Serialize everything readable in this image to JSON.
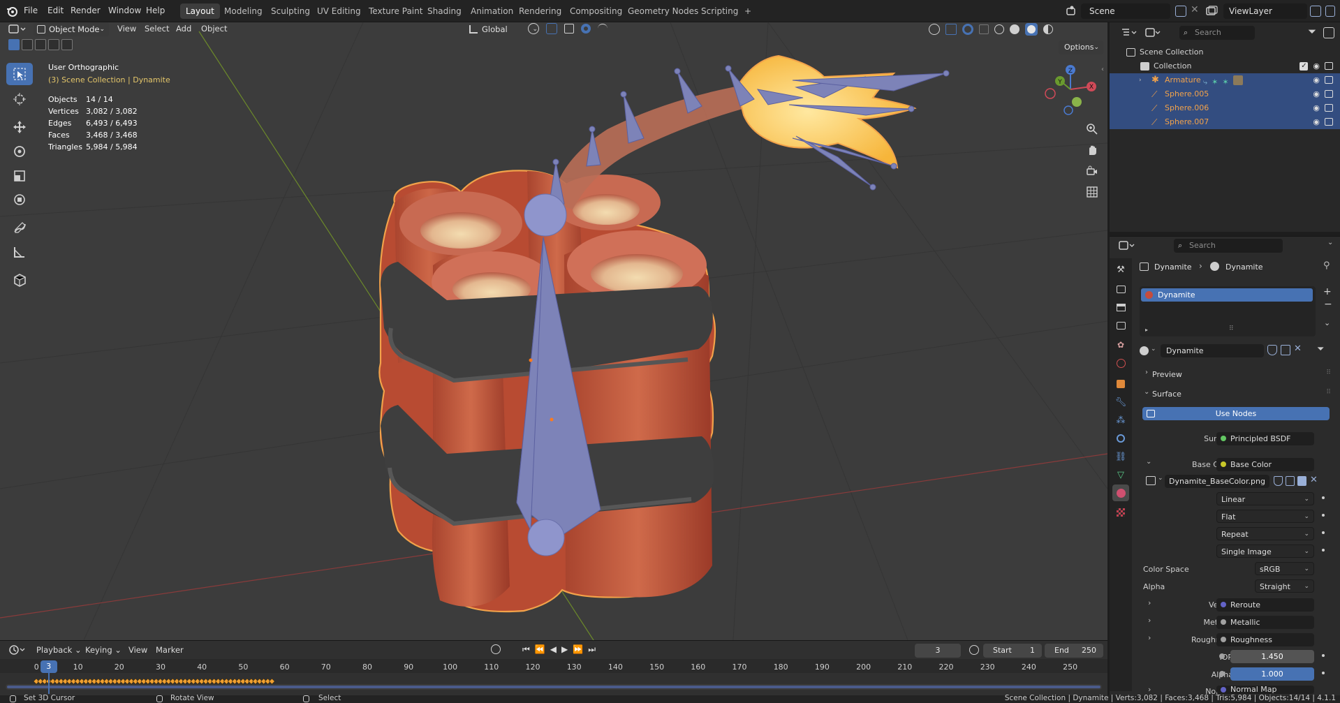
{
  "app": {
    "menus": [
      "File",
      "Edit",
      "Render",
      "Window",
      "Help"
    ],
    "workspace_tabs": [
      "Layout",
      "Modeling",
      "Sculpting",
      "UV Editing",
      "Texture Paint",
      "Shading",
      "Animation",
      "Rendering",
      "Compositing",
      "Geometry Nodes",
      "Scripting"
    ],
    "active_workspace": "Layout",
    "add_tab": "+",
    "scene_name": "Scene",
    "view_layer": "ViewLayer"
  },
  "viewport": {
    "mode": "Object Mode",
    "menus": [
      "View",
      "Select",
      "Add",
      "Object"
    ],
    "transform_orientation": "Global",
    "options_label": "Options",
    "view_name": "User Orthographic",
    "collection_path": "(3) Scene Collection | Dynamite",
    "stats": [
      {
        "label": "Objects",
        "value": "14 / 14"
      },
      {
        "label": "Vertices",
        "value": "3,082 / 3,082"
      },
      {
        "label": "Edges",
        "value": "6,493 / 6,493"
      },
      {
        "label": "Faces",
        "value": "3,468 / 3,468"
      },
      {
        "label": "Triangles",
        "value": "5,984 / 5,984"
      }
    ],
    "gizmo_axes": [
      "Z",
      "Y",
      "X"
    ]
  },
  "outliner": {
    "search_placeholder": "Search",
    "rows": [
      {
        "label": "Scene Collection",
        "color": "#e0e0e0"
      },
      {
        "label": "Collection",
        "color": "#e0e0e0"
      },
      {
        "label": "Armature",
        "color": "#f2a24a"
      },
      {
        "label": "Sphere.005",
        "color": "#f2a24a"
      },
      {
        "label": "Sphere.006",
        "color": "#f2a24a"
      },
      {
        "label": "Sphere.007",
        "color": "#f2a24a"
      }
    ]
  },
  "properties": {
    "search_placeholder": "Search",
    "breadcrumb": [
      "Dynamite",
      "Dynamite"
    ],
    "material_slot": "Dynamite",
    "material_name": "Dynamite",
    "panels": {
      "preview": "Preview",
      "surface": "Surface"
    },
    "use_nodes": "Use Nodes",
    "surface_label": "Surface",
    "surface_value": "Principled BSDF",
    "base_color_label": "Base Color",
    "base_color_value": "Base Color",
    "image_name": "Dynamite_BaseColor.png",
    "dropdowns": [
      "Linear",
      "Flat",
      "Repeat",
      "Single Image"
    ],
    "color_space_label": "Color Space",
    "color_space_value": "sRGB",
    "alpha_mode_label": "Alpha",
    "alpha_mode_value": "Straight",
    "inputs": [
      {
        "label": "Vector",
        "value": "Reroute"
      },
      {
        "label": "Metallic",
        "value": "Metallic"
      },
      {
        "label": "Roughness",
        "value": "Roughness"
      }
    ],
    "ior_label": "IOR",
    "ior_value": "1.450",
    "alpha_label": "Alpha",
    "alpha_value": "1.000",
    "normal_label": "Normal",
    "normal_value": "Normal Map"
  },
  "timeline": {
    "menus": [
      "Playback",
      "Keying",
      "View",
      "Marker"
    ],
    "current_frame": "3",
    "start_label": "Start",
    "start_value": "1",
    "end_label": "End",
    "end_value": "250",
    "ticks": [
      "0",
      "10",
      "20",
      "30",
      "40",
      "50",
      "60",
      "70",
      "80",
      "90",
      "100",
      "110",
      "120",
      "130",
      "140",
      "150",
      "160",
      "170",
      "180",
      "190",
      "200",
      "210",
      "220",
      "230",
      "240",
      "250"
    ],
    "playhead": "3"
  },
  "statusbar": {
    "left": [
      "Set 3D Cursor",
      "Rotate View",
      "Select"
    ],
    "right": "Scene Collection | Dynamite | Verts:3,082 | Faces:3,468 | Tris:5,984 | Objects:14/14 | 4.1.1"
  },
  "colors": {
    "accent": "#4772b3",
    "selection_orange": "#f2a24a",
    "viewport_bg": "#3c3c3c"
  }
}
